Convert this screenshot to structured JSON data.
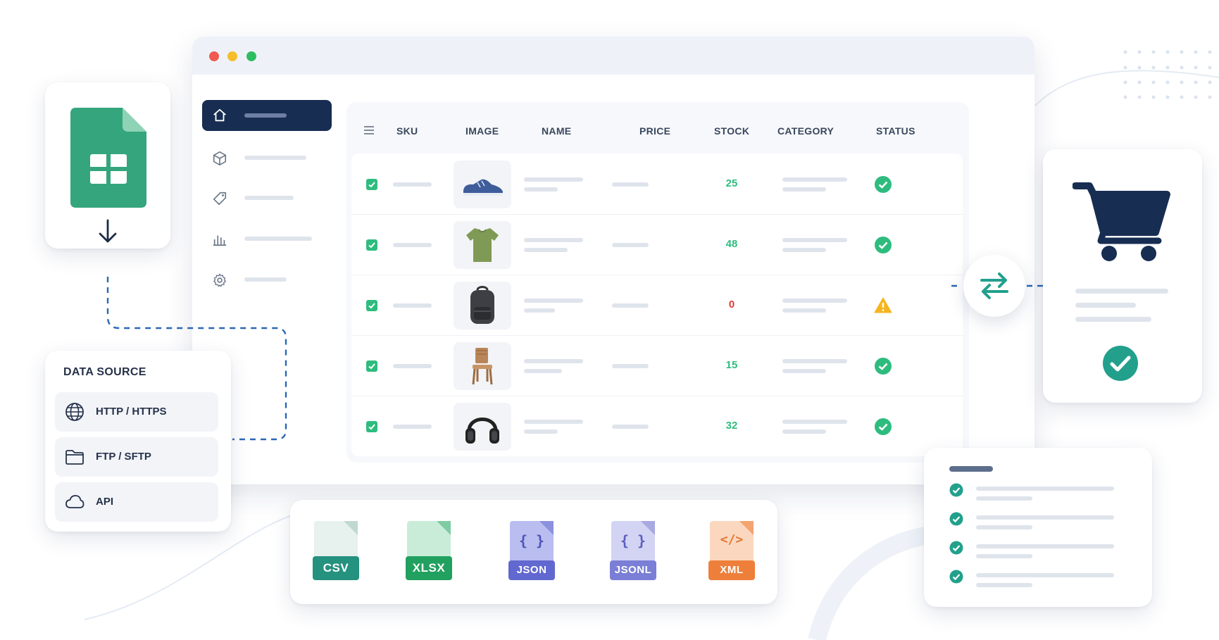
{
  "table": {
    "columns": [
      "SKU",
      "IMAGE",
      "NAME",
      "PRICE",
      "STOCK",
      "CATEGORY",
      "STATUS"
    ],
    "rows": [
      {
        "image": "sneaker",
        "stock": "25",
        "status": "ok"
      },
      {
        "image": "t-shirt",
        "stock": "48",
        "status": "ok"
      },
      {
        "image": "backpack",
        "stock": "0",
        "status": "warning"
      },
      {
        "image": "chair",
        "stock": "15",
        "status": "ok"
      },
      {
        "image": "headphones",
        "stock": "32",
        "status": "ok"
      }
    ]
  },
  "data_source": {
    "title": "DATA SOURCE",
    "items": [
      {
        "label": "HTTP / HTTPS",
        "icon": "globe-icon"
      },
      {
        "label": "FTP / SFTP",
        "icon": "folder-icon"
      },
      {
        "label": "API",
        "icon": "cloud-icon"
      }
    ]
  },
  "formats": [
    "CSV",
    "XLSX",
    "JSON",
    "JSONL",
    "XML"
  ],
  "colors": {
    "navy": "#172d52",
    "green": "#2ebc7e",
    "red": "#e03a3a",
    "warning": "#f6b51e",
    "teal": "#22a08c",
    "sheets_green": "#34a57c"
  }
}
